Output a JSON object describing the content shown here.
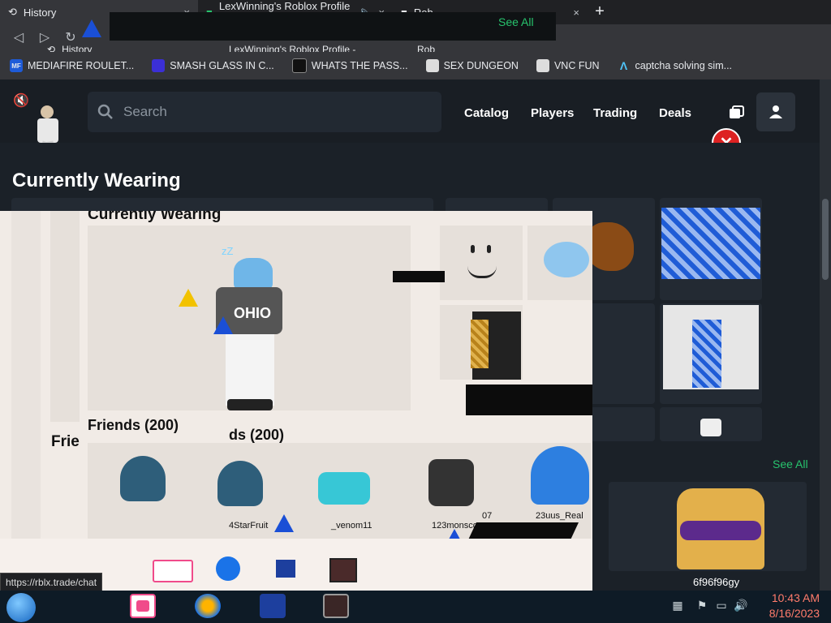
{
  "browser": {
    "tabs": [
      {
        "title": "History",
        "active": true
      },
      {
        "title": "LexWinning's Roblox Profile -",
        "active": false
      },
      {
        "title": "Rob",
        "active": false
      }
    ],
    "ghost_tabs": [
      {
        "title": "History"
      },
      {
        "title": "LexWinning's Roblox Profile -"
      },
      {
        "title": "Rob"
      }
    ],
    "new_tab": "+",
    "close": "×",
    "bookmarks": [
      {
        "label": "MEDIAFIRE ROULET...",
        "icon": "mediafire-icon",
        "iconText": "MF"
      },
      {
        "label": "SMASH GLASS IN C...",
        "icon": "smash-glass-icon",
        "iconText": ""
      },
      {
        "label": "WHATS THE PASS...",
        "icon": "whats-the-pass-icon",
        "iconText": ""
      },
      {
        "label": "SEX DUNGEON",
        "icon": "roblox-icon",
        "iconText": ""
      },
      {
        "label": "VNC FUN",
        "icon": "roblox-icon",
        "iconText": ""
      },
      {
        "label": "captcha solving sim...",
        "icon": "captcha-icon",
        "iconText": ""
      }
    ],
    "status_url": "https://rblx.trade/chat"
  },
  "site": {
    "search_placeholder": "Search",
    "nav": [
      "Catalog",
      "Players",
      "Trading",
      "Deals"
    ],
    "sections": {
      "currently_wearing": "Currently Wearing",
      "friends": "Friends (200)",
      "friends_short": "Frie",
      "friends_partial": "ds (200)",
      "see_all": "See All"
    },
    "friends": [
      "4StarFruit",
      "_venom11",
      "123monscq",
      "07",
      "23uus_Real"
    ],
    "right_friend": "6f96f96gy",
    "avatar_caption": "OHIO"
  },
  "taskbar": {
    "time": "10:43 AM",
    "date": "8/16/2023"
  },
  "colors": {
    "accent_green": "#27c36d",
    "clock": "#ff7b6b"
  }
}
